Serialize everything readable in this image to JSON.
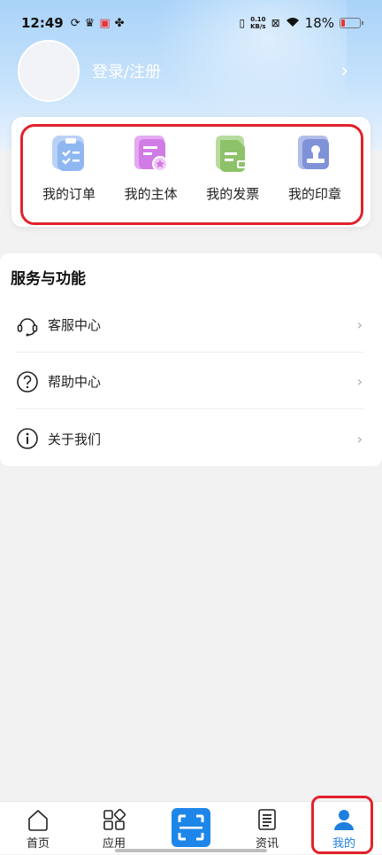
{
  "status_bar": {
    "time": "12:49",
    "net_speed_value": "0.10",
    "net_speed_unit": "KB/s",
    "battery": "18%"
  },
  "profile": {
    "login_label": "登录/注册",
    "chevron": "›"
  },
  "quick_actions": [
    {
      "label": "我的订单",
      "icon": "order-clipboard-icon",
      "color": "#8fb7f2"
    },
    {
      "label": "我的主体",
      "icon": "entity-card-icon",
      "color": "#d07be6"
    },
    {
      "label": "我的发票",
      "icon": "invoice-document-icon",
      "color": "#8ec26a"
    },
    {
      "label": "我的印章",
      "icon": "seal-stamp-icon",
      "color": "#7f92d8"
    }
  ],
  "services": {
    "title": "服务与功能",
    "items": [
      {
        "label": "客服中心",
        "icon": "headset-icon"
      },
      {
        "label": "帮助中心",
        "icon": "question-circle-icon"
      },
      {
        "label": "关于我们",
        "icon": "info-circle-icon"
      }
    ],
    "chevron": "›"
  },
  "tabbar": {
    "items": [
      {
        "label": "首页",
        "icon": "home-icon"
      },
      {
        "label": "应用",
        "icon": "apps-grid-icon"
      },
      {
        "label": "",
        "icon": "scan-icon"
      },
      {
        "label": "资讯",
        "icon": "news-document-icon"
      },
      {
        "label": "我的",
        "icon": "user-icon"
      }
    ],
    "active_index": 4,
    "accent_color": "#1f7fe0"
  },
  "colors": {
    "highlight_red": "#e1222b",
    "header_blue": "#a9d3f9"
  }
}
